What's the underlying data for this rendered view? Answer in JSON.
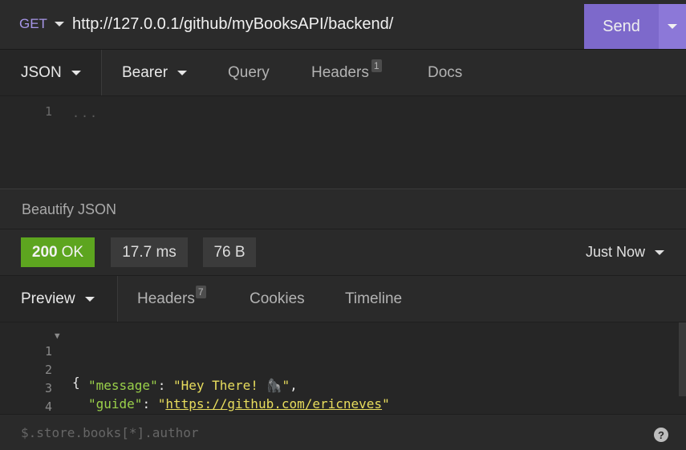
{
  "request": {
    "method": "GET",
    "url": "http://127.0.0.1/github/myBooksAPI/backend/",
    "send_label": "Send"
  },
  "request_tabs": {
    "body": "JSON",
    "auth": "Bearer",
    "query": "Query",
    "headers": "Headers",
    "headers_count": "1",
    "docs": "Docs"
  },
  "request_body": {
    "line_numbers": [
      "1"
    ],
    "placeholder": "..."
  },
  "beautify_label": "Beautify JSON",
  "status": {
    "code": "200",
    "text": "OK",
    "time": "17.7 ms",
    "size": "76 B",
    "history": "Just Now"
  },
  "response_tabs": {
    "preview": "Preview",
    "headers": "Headers",
    "headers_count": "7",
    "cookies": "Cookies",
    "timeline": "Timeline"
  },
  "response_body": {
    "line_numbers": [
      "1",
      "2",
      "3",
      "4"
    ],
    "open_brace": "{",
    "close_brace": "}",
    "message_key": "\"message\"",
    "message_value": "\"Hey There! 🦍\"",
    "guide_key": "\"guide\"",
    "guide_value_url": "https://github.com/ericneves"
  },
  "filter": {
    "placeholder": "$.store.books[*].author",
    "help_label": "?"
  },
  "colors": {
    "accent": "#7d69cb",
    "success": "#5da51f",
    "json_key": "#9ad04a",
    "json_string": "#e8dd5d"
  }
}
